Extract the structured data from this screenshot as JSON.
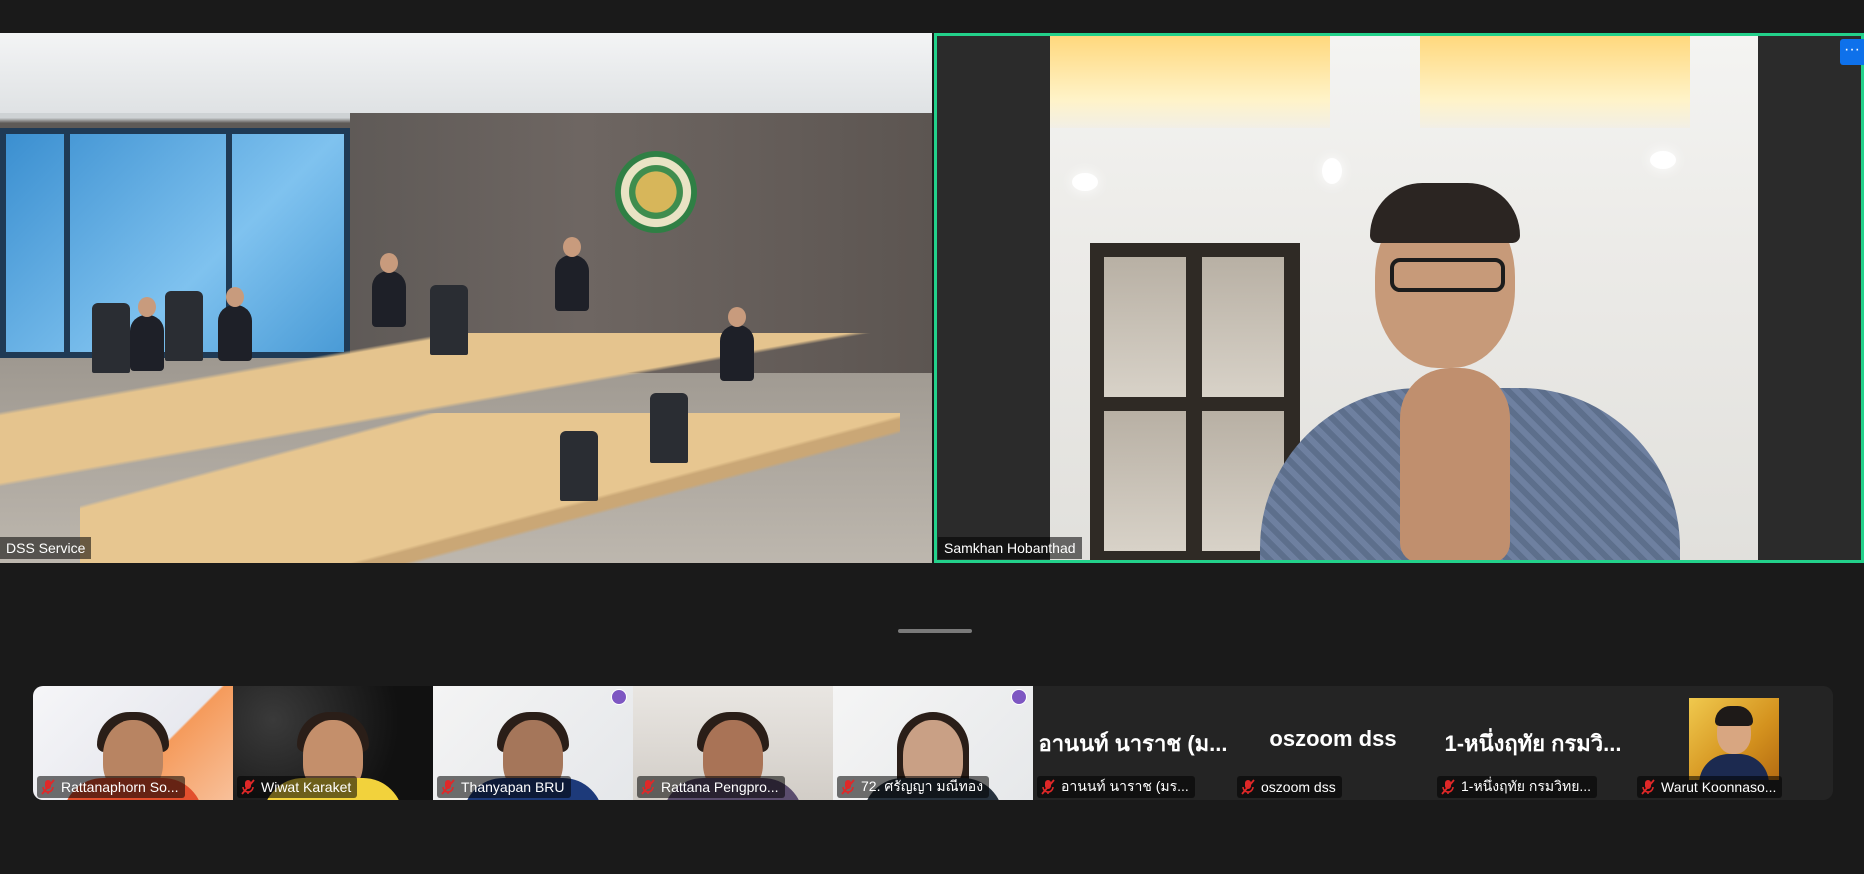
{
  "main_tiles": {
    "left": {
      "name": "DSS Service"
    },
    "right": {
      "name": "Samkhan Hobanthad",
      "more_button": "···",
      "active_speaker": true
    }
  },
  "gallery": [
    {
      "name": "Rattanaphorn So...",
      "muted": true,
      "type": "video"
    },
    {
      "name": "Wiwat Karaket",
      "muted": true,
      "type": "video"
    },
    {
      "name": "Thanyapan BRU",
      "muted": true,
      "type": "video"
    },
    {
      "name": "Rattana Pengpro...",
      "muted": true,
      "type": "video"
    },
    {
      "name": "72. ศรัญญา มณีทอง",
      "muted": true,
      "type": "video"
    },
    {
      "name": "อานนท์ นาราช (มร...",
      "display_name": "อานนท์ นาราช (ม...",
      "muted": true,
      "type": "name"
    },
    {
      "name": "oszoom dss",
      "display_name": "oszoom dss",
      "muted": true,
      "type": "name"
    },
    {
      "name": "1-หนึ่งฤทัย กรมวิทย...",
      "display_name": "1-หนึ่งฤทัย กรมวิ...",
      "muted": true,
      "type": "name"
    },
    {
      "name": "Warut Koonnaso...",
      "muted": true,
      "type": "photo"
    }
  ],
  "colors": {
    "background": "#1a1a1a",
    "active_speaker_border": "#23d18b",
    "more_button": "#0e71eb",
    "muted_icon": "#e02828"
  },
  "icons": {
    "mic_off": "mic-off-icon",
    "more": "more-options-icon"
  }
}
